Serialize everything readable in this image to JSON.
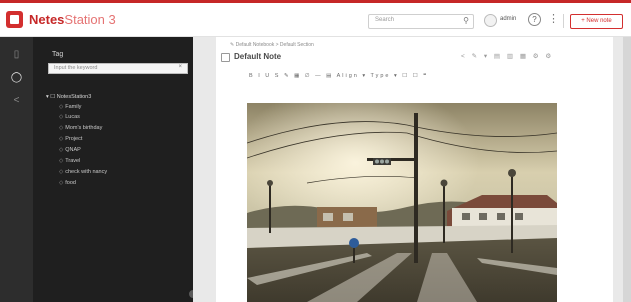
{
  "app": {
    "brand_bold": "Netes",
    "brand_light": "Station 3"
  },
  "topbar": {
    "search_placeholder": "Search",
    "search_icon": "search-icon",
    "user_name": "admin",
    "help_icon": "help-icon",
    "more_icon": "more-vertical-icon",
    "new_note_label": "+ New note"
  },
  "rail": {
    "items": [
      "notebook-icon",
      "tag-icon",
      "share-icon"
    ]
  },
  "tagpanel": {
    "title": "Tag",
    "input_placeholder": "Input the keyword",
    "root_label": "NotesStation3",
    "tags": [
      "Family",
      "Lucas",
      "Mom's birthday",
      "Project",
      "QNAP",
      "Travel",
      "check with nancy",
      "food"
    ]
  },
  "note": {
    "breadcrumb": "Default Notebook > Default Section",
    "title": "Default Note",
    "actions": "< ✎ ▾ ▤ ▥ ▦ ⚙ ⚙",
    "format_tools": "B I U S ✎ ▦ ∅ — ▤ Align ▾ Type ▾ ☐ ☐ ❝"
  },
  "colors": {
    "accent": "#c62828",
    "sidebar_dark": "#1f1f1f",
    "rail_dark": "#2d2d2d",
    "gutter": "#e9e9e9"
  }
}
